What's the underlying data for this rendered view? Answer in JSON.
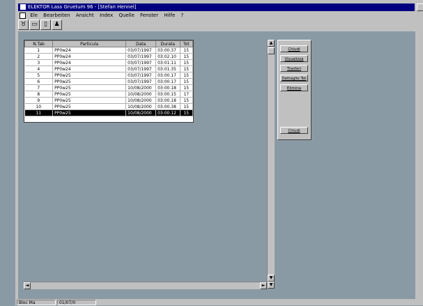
{
  "window": {
    "title": "ELEKTOR Lass Gruetum 96 - [Stefan Hennel]"
  },
  "menubar": {
    "items": [
      "Ele",
      "Bearbeiten",
      "Ansicht",
      "Index",
      "Quelle",
      "Fenster",
      "Hilfe",
      "?"
    ]
  },
  "toolbar": {
    "buttons": [
      {
        "icon": "binoculars-icon",
        "glyph": "♉"
      },
      {
        "icon": "monitor-icon",
        "glyph": "▭"
      },
      {
        "icon": "document-icon",
        "glyph": "▯"
      },
      {
        "icon": "person-icon",
        "glyph": "♟"
      }
    ]
  },
  "table": {
    "columns": [
      "N.Tab",
      "Particula",
      "Data",
      "Durata",
      "Tot"
    ],
    "rows": [
      [
        "1",
        "PP0w24",
        "03/07/1997",
        "03:00.37",
        "15"
      ],
      [
        "2",
        "PP0w24",
        "03/07/1997",
        "03:02.10",
        "15"
      ],
      [
        "3",
        "PP0w24",
        "03/07/1997",
        "03:01.11",
        "15"
      ],
      [
        "4",
        "PP0w24",
        "03/07/1997",
        "03:01.35",
        "15"
      ],
      [
        "5",
        "PP0w25",
        "03/07/1997",
        "03:00.17",
        "15"
      ],
      [
        "6",
        "PP0w25",
        "03/07/1997",
        "03:00.17",
        "15"
      ],
      [
        "7",
        "PP0w25",
        "10/08/2000",
        "03:00.18",
        "15"
      ],
      [
        "8",
        "PP0w25",
        "10/08/2000",
        "03:00.15",
        "17"
      ],
      [
        "9",
        "PP0w25",
        "10/08/2000",
        "03:00.18",
        "15"
      ],
      [
        "10",
        "PP0w25",
        "10/08/2000",
        "03:00.38",
        "15"
      ],
      [
        "11",
        "PP0w25",
        "10/08/2000",
        "03:00.12",
        "15"
      ]
    ],
    "selected_row": 10
  },
  "panel": {
    "buttons": [
      "Chiudi",
      "Visualizza",
      "Trasferi",
      "Dettaglio Tot",
      "Elimina"
    ],
    "close_label": "Chiudi"
  },
  "status": {
    "pane1": "Bloc Ma",
    "pane2": "01/07/0"
  },
  "scroll": {
    "up": "▲",
    "down": "▼",
    "left": "◄",
    "right": "►"
  }
}
